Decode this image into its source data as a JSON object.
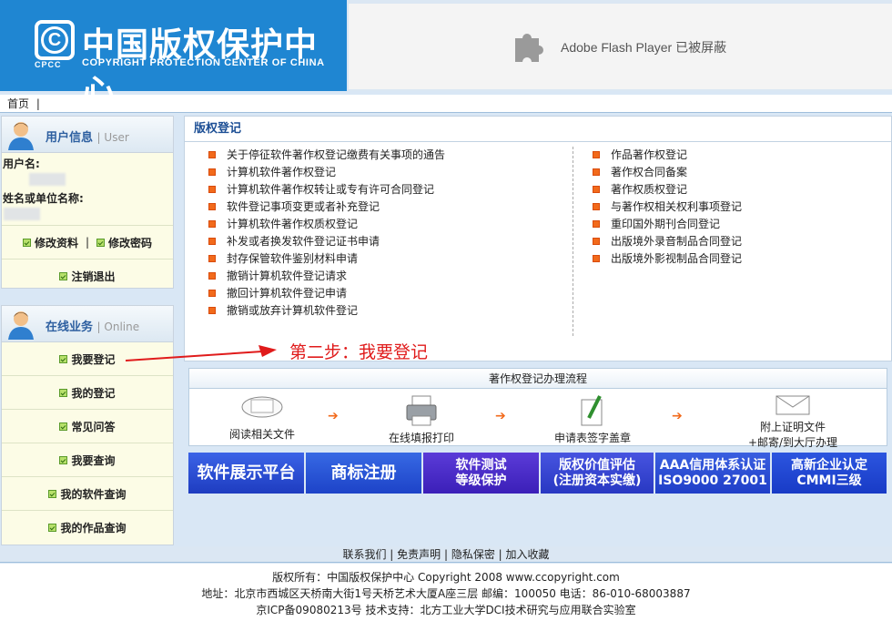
{
  "header": {
    "logo_cpcc": "CPCC",
    "logo_cn": "中国版权保护中心",
    "logo_en": "COPYRIGHT PROTECTION CENTER OF CHINA",
    "flash_text": "Adobe Flash Player 已被屏蔽"
  },
  "topnav": {
    "home": "首页",
    "sep": "|"
  },
  "user_panel": {
    "title": "用户信息",
    "subtitle": "| User",
    "username_label": "用户名:",
    "org_label": "姓名或单位名称:",
    "edit_profile": "修改资料",
    "sep": "|",
    "change_password": "修改密码",
    "logout": "注销退出"
  },
  "biz_panel": {
    "title": "在线业务",
    "subtitle": "| Online",
    "items": [
      "我要登记",
      "我的登记",
      "常见问答",
      "我要查询",
      "我的软件查询",
      "我的作品查询"
    ]
  },
  "main": {
    "title": "版权登记",
    "left_links": [
      "关于停征软件著作权登记缴费有关事项的通告",
      "计算机软件著作权登记",
      "计算机软件著作权转让或专有许可合同登记",
      "软件登记事项变更或者补充登记",
      "计算机软件著作权质权登记",
      "补发或者换发软件登记证书申请",
      "封存保管软件鉴别材料申请",
      "撤销计算机软件登记请求",
      "撤回计算机软件登记申请",
      "撤销或放弃计算机软件登记"
    ],
    "right_links": [
      "作品著作权登记",
      "著作权合同备案",
      "著作权质权登记",
      "与著作权相关权利事项登记",
      "重印国外期刊合同登记",
      "出版境外录音制品合同登记",
      "出版境外影视制品合同登记"
    ]
  },
  "annotation": {
    "text": "第二步：我要登记",
    "color": "#e01b1b"
  },
  "flow": {
    "title": "著作权登记办理流程",
    "steps": [
      "阅读相关文件",
      "在线填报打印",
      "申请表签字盖章"
    ],
    "step4_line1": "附上证明文件",
    "step4_line2": "+邮寄/到大厅办理",
    "arrow": "➔"
  },
  "banners": {
    "b1": "软件展示平台",
    "b2": "商标注册",
    "b3_l1": "软件测试",
    "b3_l2": "等级保护",
    "b4_l1": "版权价值评估",
    "b4_l2": "(注册资本实缴)",
    "b5_l1": "AAA信用体系认证",
    "b5_l2": "ISO9000 27001",
    "b6_l1": "高新企业认定",
    "b6_l2": "CMMI三级"
  },
  "footer": {
    "links": [
      "联系我们",
      "免责声明",
      "隐私保密",
      "加入收藏"
    ],
    "line1": "版权所有：中国版权保护中心 Copyright 2008 www.ccopyright.com",
    "line2": "地址：北京市西城区天桥南大街1号天桥艺术大厦A座三层 邮编：100050 电话：86-010-68003887",
    "line3": "京ICP备09080213号 技术支持：北方工业大学DCI技术研究与应用联合实验室"
  },
  "colors": {
    "brand_blue": "#1f86d2",
    "accent_orange": "#f26a1b",
    "title_blue": "#1d4f95"
  }
}
